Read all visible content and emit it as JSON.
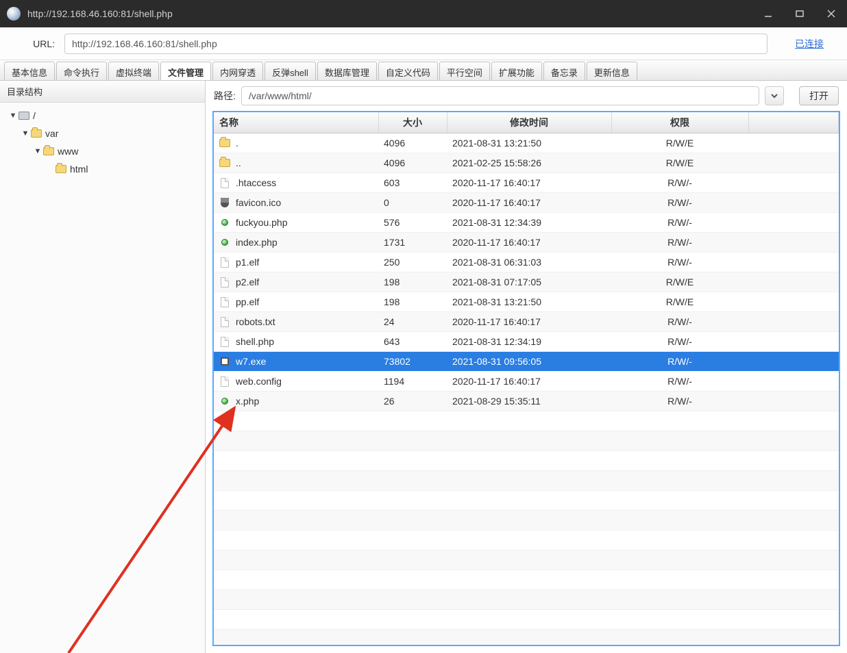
{
  "window": {
    "title": "http://192.168.46.160:81/shell.php"
  },
  "urlbar": {
    "label": "URL:",
    "value": "http://192.168.46.160:81/shell.php",
    "status": "已连接"
  },
  "tabs": [
    "基本信息",
    "命令执行",
    "虚拟终端",
    "文件管理",
    "内网穿透",
    "反弹shell",
    "数据库管理",
    "自定义代码",
    "平行空间",
    "扩展功能",
    "备忘录",
    "更新信息"
  ],
  "active_tab_index": 3,
  "sidebar": {
    "title": "目录结构",
    "tree": [
      {
        "indent": 0,
        "toggle": "▼",
        "icon": "disk",
        "label": "/"
      },
      {
        "indent": 1,
        "toggle": "▼",
        "icon": "folder",
        "label": "var"
      },
      {
        "indent": 2,
        "toggle": "▼",
        "icon": "folder",
        "label": "www"
      },
      {
        "indent": 3,
        "toggle": "",
        "icon": "folder",
        "label": "html"
      }
    ]
  },
  "pathbar": {
    "label": "路径:",
    "value": "/var/www/html/",
    "open_label": "打开"
  },
  "table": {
    "columns": [
      "名称",
      "大小",
      "修改时间",
      "权限"
    ],
    "rows": [
      {
        "icon": "folder",
        "name": ".",
        "size": "4096",
        "time": "2021-08-31 13:21:50",
        "perm": "R/W/E"
      },
      {
        "icon": "folder",
        "name": "..",
        "size": "4096",
        "time": "2021-02-25 15:58:26",
        "perm": "R/W/E"
      },
      {
        "icon": "page",
        "name": ".htaccess",
        "size": "603",
        "time": "2020-11-17 16:40:17",
        "perm": "R/W/-"
      },
      {
        "icon": "shield",
        "name": "favicon.ico",
        "size": "0",
        "time": "2020-11-17 16:40:17",
        "perm": "R/W/-"
      },
      {
        "icon": "green",
        "name": "fuckyou.php",
        "size": "576",
        "time": "2021-08-31 12:34:39",
        "perm": "R/W/-"
      },
      {
        "icon": "green",
        "name": "index.php",
        "size": "1731",
        "time": "2020-11-17 16:40:17",
        "perm": "R/W/-"
      },
      {
        "icon": "page",
        "name": "p1.elf",
        "size": "250",
        "time": "2021-08-31 06:31:03",
        "perm": "R/W/-"
      },
      {
        "icon": "page",
        "name": "p2.elf",
        "size": "198",
        "time": "2021-08-31 07:17:05",
        "perm": "R/W/E"
      },
      {
        "icon": "page",
        "name": "pp.elf",
        "size": "198",
        "time": "2021-08-31 13:21:50",
        "perm": "R/W/E"
      },
      {
        "icon": "page",
        "name": "robots.txt",
        "size": "24",
        "time": "2020-11-17 16:40:17",
        "perm": "R/W/-"
      },
      {
        "icon": "page",
        "name": "shell.php",
        "size": "643",
        "time": "2021-08-31 12:34:19",
        "perm": "R/W/-"
      },
      {
        "icon": "exe",
        "name": "w7.exe",
        "size": "73802",
        "time": "2021-08-31 09:56:05",
        "perm": "R/W/-",
        "selected": true
      },
      {
        "icon": "page",
        "name": "web.config",
        "size": "1194",
        "time": "2020-11-17 16:40:17",
        "perm": "R/W/-"
      },
      {
        "icon": "green",
        "name": "x.php",
        "size": "26",
        "time": "2021-08-29 15:35:11",
        "perm": "R/W/-"
      }
    ]
  }
}
